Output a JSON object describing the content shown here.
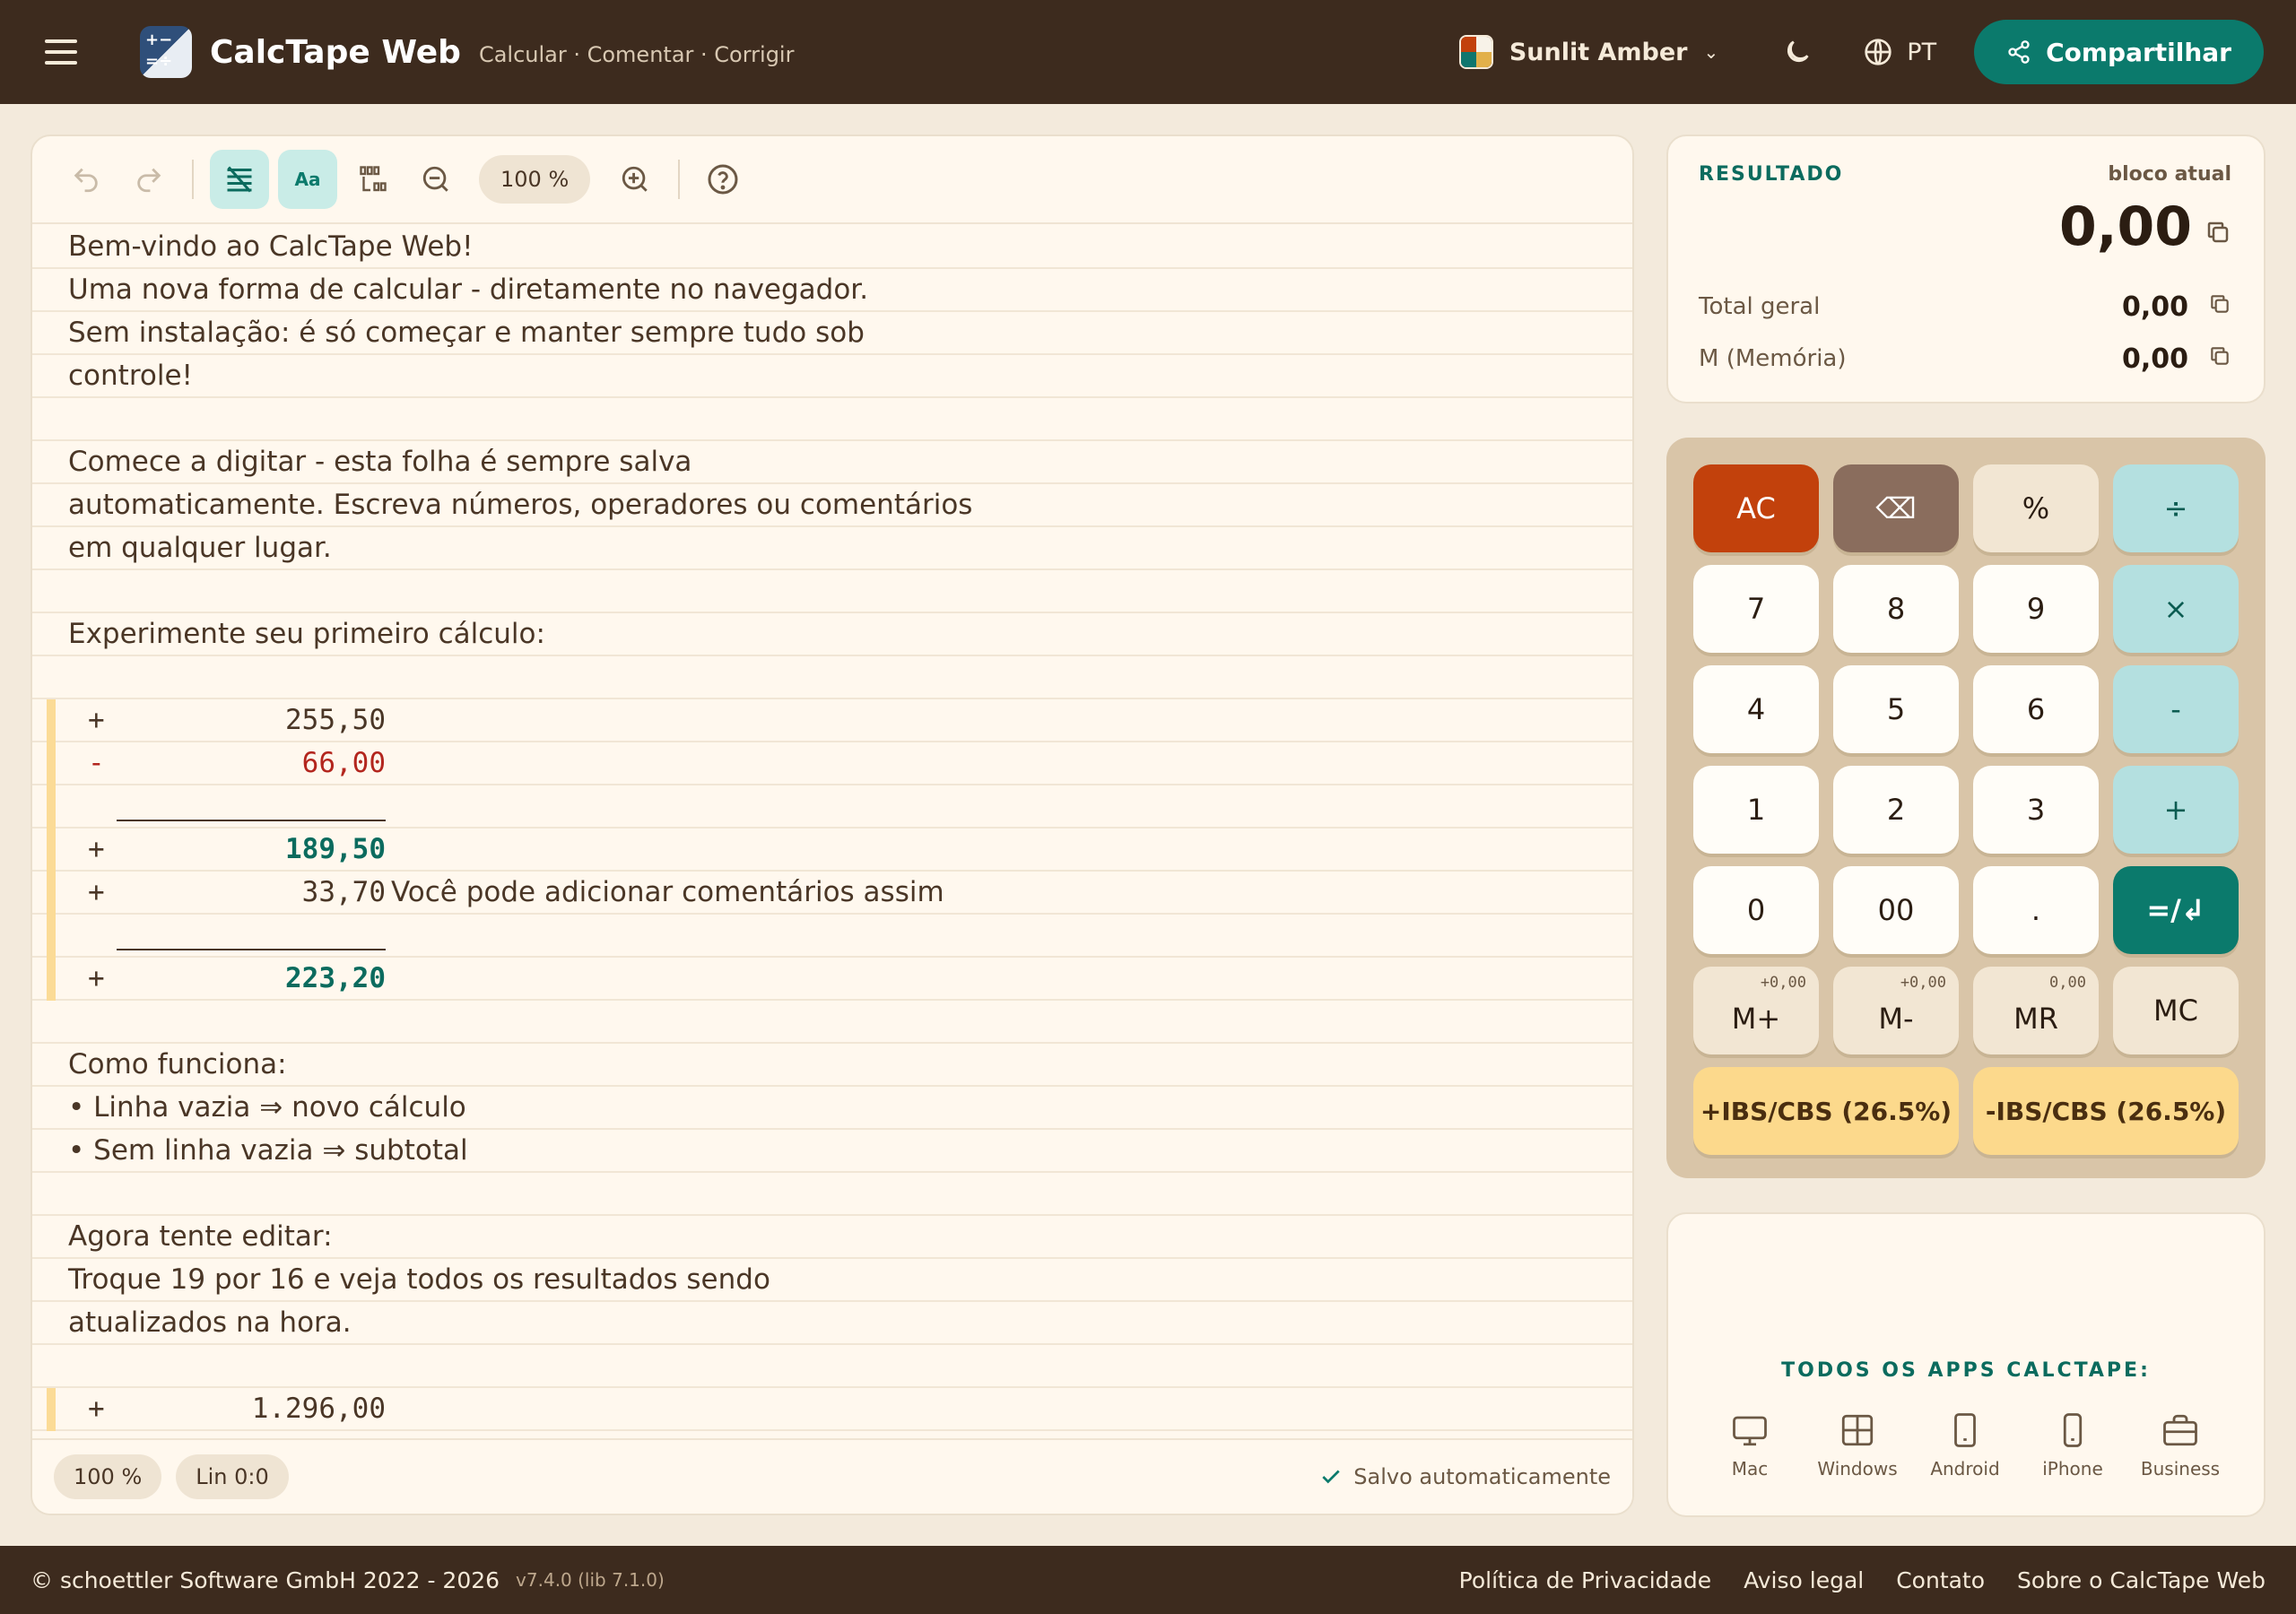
{
  "header": {
    "app_title": "CalcTape Web",
    "tagline": "Calcular · Comentar · Corrigir",
    "theme_name": "Sunlit Amber",
    "language": "PT",
    "share_label": "Compartilhar"
  },
  "toolbar": {
    "zoom": "100 %",
    "format_label": "Aa"
  },
  "editor": {
    "text_lines": [
      "Bem-vindo ao CalcTape Web!",
      "Uma nova forma de calcular - diretamente no navegador.",
      "Sem instalação: é só começar e manter sempre tudo sob",
      "controle!",
      "",
      "Comece a digitar - esta folha é sempre salva",
      "automaticamente. Escreva números, operadores ou comentários",
      "em qualquer lugar.",
      "",
      "Experimente seu primeiro cálculo:",
      "",
      "Como funciona:",
      "• Linha vazia ⇒ novo cálculo",
      "• Sem linha vazia ⇒ subtotal",
      "",
      "Agora tente editar:",
      "Troque 19 por 16 e veja todos os resultados sendo",
      "atualizados na hora."
    ],
    "calc_lines": [
      {
        "op": "+",
        "value": "255,50",
        "comment": ""
      },
      {
        "op": "-",
        "value": "66,00",
        "comment": ""
      },
      {
        "op": "+",
        "value": "189,50",
        "comment": ""
      },
      {
        "op": "+",
        "value": "33,70",
        "comment": "Você pode adicionar comentários assim"
      },
      {
        "op": "+",
        "value": "223,20",
        "comment": ""
      },
      {
        "op": "+",
        "value": "1.296,00",
        "comment": ""
      }
    ]
  },
  "statusbar": {
    "zoom": "100 %",
    "position": "Lin 0:0",
    "saved": "Salvo automaticamente"
  },
  "result": {
    "label": "RESULTADO",
    "scope": "bloco atual",
    "value": "0,00",
    "total_label": "Total geral",
    "total_value": "0,00",
    "memory_label": "M (Memória)",
    "memory_value": "0,00"
  },
  "keypad": {
    "rows": [
      [
        "AC",
        "⌫",
        "%",
        "÷"
      ],
      [
        "7",
        "8",
        "9",
        "×"
      ],
      [
        "4",
        "5",
        "6",
        "-"
      ],
      [
        "1",
        "2",
        "3",
        "+"
      ],
      [
        "0",
        "00",
        ".",
        "=/↲"
      ]
    ],
    "memory": [
      {
        "label": "M+",
        "sub": "+0,00"
      },
      {
        "label": "M-",
        "sub": "+0,00"
      },
      {
        "label": "MR",
        "sub": "0,00"
      },
      {
        "label": "MC",
        "sub": ""
      }
    ],
    "tax_plus": "+IBS/CBS (26.5%)",
    "tax_minus": "-IBS/CBS (26.5%)"
  },
  "apps": {
    "title": "TODOS OS APPS CALCTAPE:",
    "items": [
      "Mac",
      "Windows",
      "Android",
      "iPhone",
      "Business"
    ]
  },
  "footer": {
    "copyright": "© schoettler Software GmbH 2022 - 2026",
    "version": "v7.4.0 (lib 7.1.0)",
    "links": [
      "Política de Privacidade",
      "Aviso legal",
      "Contato",
      "Sobre o CalcTape Web"
    ]
  },
  "colors": {
    "header_bg": "#3d2b1e",
    "accent_teal": "#0b7a6c",
    "ac_red": "#c2410c",
    "tax_amber": "#fcd98c",
    "minus_red": "#b3261e"
  }
}
